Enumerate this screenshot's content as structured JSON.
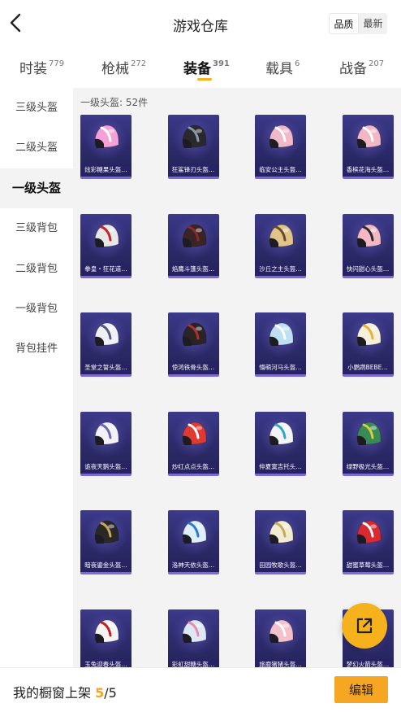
{
  "header": {
    "title": "游戏仓库",
    "sort_options": [
      {
        "label": "品质",
        "active": true
      },
      {
        "label": "最新",
        "active": false
      }
    ]
  },
  "tabs": [
    {
      "label": "时装",
      "count": "779",
      "active": false
    },
    {
      "label": "枪械",
      "count": "272",
      "active": false
    },
    {
      "label": "装备",
      "count": "391",
      "active": true
    },
    {
      "label": "载具",
      "count": "6",
      "active": false
    },
    {
      "label": "战备",
      "count": "207",
      "active": false
    }
  ],
  "sidebar": {
    "items": [
      {
        "label": "三级头盔",
        "active": false
      },
      {
        "label": "二级头盔",
        "active": false
      },
      {
        "label": "一级头盔",
        "active": true
      },
      {
        "label": "三级背包",
        "active": false
      },
      {
        "label": "二级背包",
        "active": false
      },
      {
        "label": "一级背包",
        "active": false
      },
      {
        "label": "背包挂件",
        "active": false
      }
    ]
  },
  "content": {
    "heading": "一级头盔: 52件",
    "items": [
      {
        "label": "炫彩糖果头盔…",
        "helmet": "#f5a0d8",
        "accent": "#ffffff"
      },
      {
        "label": "狂鲨锋刃头盔…",
        "helmet": "#2a2a2e",
        "accent": "#8899aa"
      },
      {
        "label": "临安公主头盔…",
        "helmet": "#f0b8c8",
        "accent": "#ffffff"
      },
      {
        "label": "香槟花海头盔…",
        "helmet": "#f2b7c4",
        "accent": "#ffffff"
      },
      {
        "label": "拳皇・狂花道…",
        "helmet": "#e8e8e8",
        "accent": "#c0262c"
      },
      {
        "label": "焰鹰斗篷头盔…",
        "helmet": "#3a2426",
        "accent": "#8a2a2a"
      },
      {
        "label": "沙丘之主头盔…",
        "helmet": "#e0c48a",
        "accent": "#6a4a22"
      },
      {
        "label": "快闪甜心头盔…",
        "helmet": "#f2b8c4",
        "accent": "#2a2a2a"
      },
      {
        "label": "圣堂之誓头盔…",
        "helmet": "#f0f0f4",
        "accent": "#555a7a"
      },
      {
        "label": "惊鸿铁骨头盔…",
        "helmet": "#2a2426",
        "accent": "#b03030"
      },
      {
        "label": "懵萌河马头盔…",
        "helmet": "#bfe0f2",
        "accent": "#ffffff"
      },
      {
        "label": "小鹦鹉BEBE…",
        "helmet": "#f5f0dc",
        "accent": "#e8b030"
      },
      {
        "label": "诡夜天鹅头盔…",
        "helmet": "#f2f2f6",
        "accent": "#6a6ab0"
      },
      {
        "label": "炒红点点头盔…",
        "helmet": "#e03a30",
        "accent": "#ffffff"
      },
      {
        "label": "仲夏寞吉托头…",
        "helmet": "#f4f4f4",
        "accent": "#2aa8c8"
      },
      {
        "label": "绿野极光头盔…",
        "helmet": "#3a8a58",
        "accent": "#d8d030"
      },
      {
        "label": "暗夜鎏金头盔…",
        "helmet": "#2a2826",
        "accent": "#c8a860"
      },
      {
        "label": "洛神天依头盔…",
        "helmet": "#dfeef8",
        "accent": "#2a7ad0"
      },
      {
        "label": "田园牧歌头盔…",
        "helmet": "#f2ecd0",
        "accent": "#caa860"
      },
      {
        "label": "甜蜜草莓头盔…",
        "helmet": "#d82a30",
        "accent": "#ffffff"
      },
      {
        "label": "玉兔迎春头盔…",
        "helmet": "#f4f4f4",
        "accent": "#c02028"
      },
      {
        "label": "彩虹甜糖头盔…",
        "helmet": "#dce8f4",
        "accent": "#e88ab0"
      },
      {
        "label": "旅鹿猪猪头盔…",
        "helmet": "#f4c0cc",
        "accent": "#ffffff"
      },
      {
        "label": "梦幻火箭头盔…",
        "helmet": "#4a5a9a",
        "accent": "#f0c040"
      }
    ]
  },
  "fab": {
    "icon": "share-icon"
  },
  "bottom": {
    "shelf_prefix": "我的橱窗上架",
    "shelf_current": "5",
    "shelf_total": "/5",
    "edit_label": "编辑"
  },
  "colors": {
    "accent": "#f5a623",
    "card_bg": "#2c2a6a",
    "content_bg": "#f3f3f4"
  }
}
